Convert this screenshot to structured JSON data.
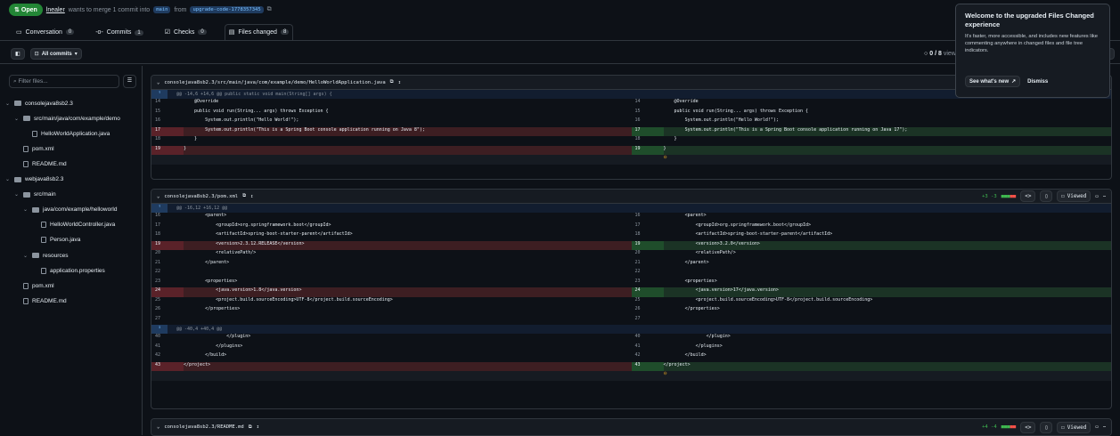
{
  "pr": {
    "state": "Open",
    "author": "lnealer",
    "summary_mid": "wants to merge 1 commit into",
    "base": "main",
    "from_word": "from",
    "head": "upgrade-code-1778357345"
  },
  "tabs": [
    {
      "label": "Conversation",
      "count": "0"
    },
    {
      "label": "Commits",
      "count": "1"
    },
    {
      "label": "Checks",
      "count": "0"
    },
    {
      "label": "Files changed",
      "count": "8"
    }
  ],
  "toolbar": {
    "commits_label": "All commits",
    "viewed_progress": "0 / 8",
    "viewed_suffix": "viewed"
  },
  "sidebar": {
    "filter_placeholder": "Filter files...",
    "items": [
      {
        "label": "consolejava8sb2.3",
        "kind": "folder"
      },
      {
        "label": "src/main/java/com/example/demo",
        "kind": "folder"
      },
      {
        "label": "HelloWorldApplication.java",
        "kind": "file"
      },
      {
        "label": "pom.xml",
        "kind": "file"
      },
      {
        "label": "README.md",
        "kind": "file"
      },
      {
        "label": "webjava8sb2.3",
        "kind": "folder"
      },
      {
        "label": "src/main",
        "kind": "folder"
      },
      {
        "label": "java/com/example/helloworld",
        "kind": "folder"
      },
      {
        "label": "HelloWorldController.java",
        "kind": "file"
      },
      {
        "label": "Person.java",
        "kind": "file"
      },
      {
        "label": "resources",
        "kind": "folder"
      },
      {
        "label": "application.properties",
        "kind": "file"
      },
      {
        "label": "pom.xml",
        "kind": "file"
      },
      {
        "label": "README.md",
        "kind": "file"
      }
    ]
  },
  "files": [
    {
      "path": "consolejava8sb2.3/src/main/java/com/example/demo/HelloWorldApplication.java",
      "hunk": "@@ -14,6 +14,6 @@ public static void main(String[] args) {",
      "lines": [
        {
          "l": "14",
          "r": "14",
          "left": "    @Override",
          "right": "    @Override"
        },
        {
          "l": "15",
          "r": "15",
          "left": "    public void run(String... args) throws Exception {",
          "right": "    public void run(String... args) throws Exception {"
        },
        {
          "l": "16",
          "r": "16",
          "left": "        System.out.println(\"Hello World!\");",
          "right": "        System.out.println(\"Hello World!\");"
        },
        {
          "l": "17",
          "r": "17",
          "left": "        System.out.println(\"This is a Spring Boot console application running on Java 8\");",
          "right": "        System.out.println(\"This is a Spring Boot console application running on Java 17\");",
          "type": "change"
        },
        {
          "l": "18",
          "r": "18",
          "left": "    }",
          "right": "    }"
        },
        {
          "l": "19",
          "r": "19",
          "left": "}",
          "right": "}",
          "type": "change"
        }
      ]
    },
    {
      "path": "consolejava8sb2.3/pom.xml",
      "stat": "+3 -3",
      "viewed": "Viewed",
      "hunk": "@@ -16,12 +16,12 @@",
      "hunk2": "@@ -40,4 +40,4 @@",
      "lines": [
        {
          "l": "16",
          "r": "16",
          "left": "        <parent>",
          "right": "        <parent>"
        },
        {
          "l": "17",
          "r": "17",
          "left": "            <groupId>org.springframework.boot</groupId>",
          "right": "            <groupId>org.springframework.boot</groupId>"
        },
        {
          "l": "18",
          "r": "18",
          "left": "            <artifactId>spring-boot-starter-parent</artifactId>",
          "right": "            <artifactId>spring-boot-starter-parent</artifactId>"
        },
        {
          "l": "19",
          "r": "19",
          "left": "            <version>2.3.12.RELEASE</version>",
          "right": "            <version>3.2.0</version>",
          "type": "change"
        },
        {
          "l": "20",
          "r": "20",
          "left": "            <relativePath/>",
          "right": "            <relativePath/>"
        },
        {
          "l": "21",
          "r": "21",
          "left": "        </parent>",
          "right": "        </parent>"
        },
        {
          "l": "22",
          "r": "22",
          "left": "",
          "right": ""
        },
        {
          "l": "23",
          "r": "23",
          "left": "        <properties>",
          "right": "        <properties>"
        },
        {
          "l": "24",
          "r": "24",
          "left": "            <java.version>1.8</java.version>",
          "right": "            <java.version>17</java.version>",
          "type": "change"
        },
        {
          "l": "25",
          "r": "25",
          "left": "            <project.build.sourceEncoding>UTF-8</project.build.sourceEncoding>",
          "right": "            <project.build.sourceEncoding>UTF-8</project.build.sourceEncoding>"
        },
        {
          "l": "26",
          "r": "26",
          "left": "        </properties>",
          "right": "        </properties>"
        },
        {
          "l": "27",
          "r": "27",
          "left": "",
          "right": ""
        }
      ],
      "lines2": [
        {
          "l": "40",
          "r": "40",
          "left": "                </plugin>",
          "right": "                </plugin>"
        },
        {
          "l": "41",
          "r": "41",
          "left": "            </plugins>",
          "right": "            </plugins>"
        },
        {
          "l": "42",
          "r": "42",
          "left": "        </build>",
          "right": "        </build>"
        },
        {
          "l": "43",
          "r": "43",
          "left": "</project>",
          "right": "</project>",
          "type": "change"
        }
      ]
    },
    {
      "path": "consolejava8sb2.3/README.md",
      "stat": "+4 -4",
      "viewed": "Viewed"
    }
  ],
  "popup": {
    "title": "Welcome to the upgraded Files Changed experience",
    "body": "It's faster, more accessible, and includes new features like commenting anywhere in changed files and file tree indicators.",
    "primary": "See what's new",
    "dismiss": "Dismiss"
  },
  "colors": {
    "accent": "#238636",
    "del": "#3d1e22",
    "add": "#1b3325"
  }
}
